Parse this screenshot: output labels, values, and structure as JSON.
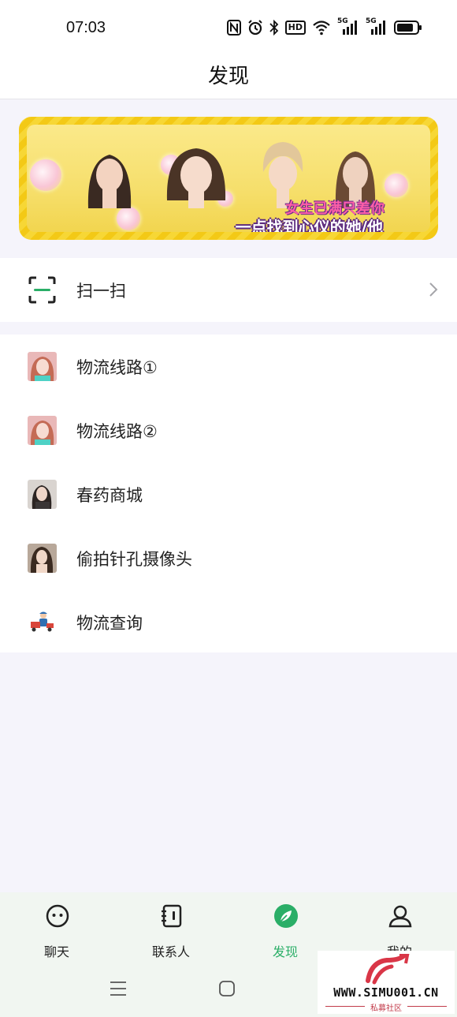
{
  "status_bar": {
    "time": "07:03",
    "icons": [
      "nfc-icon",
      "alarm-icon",
      "bluetooth-icon",
      "hd-icon",
      "wifi-icon",
      "5g-signal-icon",
      "5g-signal-icon",
      "battery-icon"
    ],
    "hd_label": "HD",
    "net_label_1": "5G",
    "net_label_2": "5G"
  },
  "nav": {
    "title": "发现"
  },
  "banner": {
    "line1": "女生已满只差你",
    "line2": "一点找到心仪的她/他",
    "colors": {
      "frame": "#f3c916",
      "inner": "#f6df6c"
    }
  },
  "scan": {
    "label": "扫一扫",
    "icon": "scan-icon"
  },
  "items": [
    {
      "label": "物流线路①",
      "icon": "avatar-icon"
    },
    {
      "label": "物流线路②",
      "icon": "avatar-icon"
    },
    {
      "label": "春药商城",
      "icon": "avatar-icon"
    },
    {
      "label": "偷拍针孔摄像头",
      "icon": "avatar-icon"
    },
    {
      "label": "物流查询",
      "icon": "delivery-icon"
    }
  ],
  "tabs": [
    {
      "label": "聊天",
      "icon": "chat-icon",
      "active": false
    },
    {
      "label": "联系人",
      "icon": "contacts-icon",
      "active": false
    },
    {
      "label": "发现",
      "icon": "discover-icon",
      "active": true
    },
    {
      "label": "我的",
      "icon": "profile-icon",
      "active": false
    }
  ],
  "colors": {
    "accent": "#2aae67",
    "background": "#f5f4fb"
  },
  "watermark": {
    "site": "WWW.SIMU001.CN",
    "sub": "私募社区"
  }
}
